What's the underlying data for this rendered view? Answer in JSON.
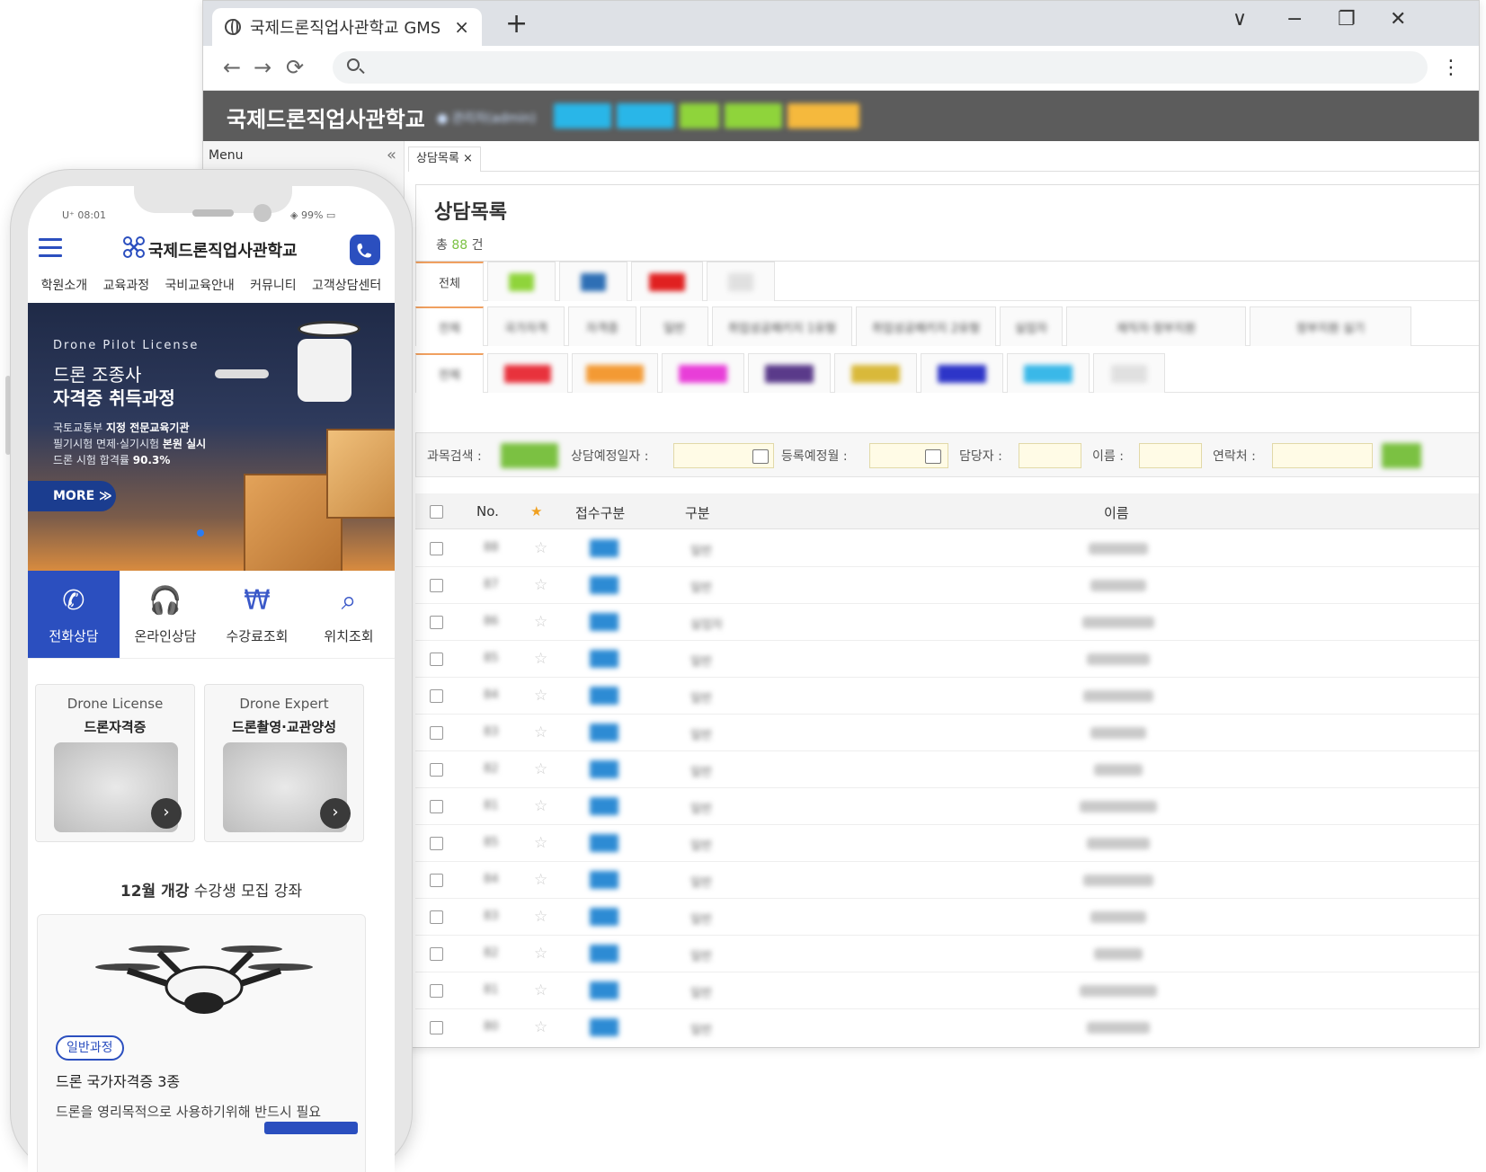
{
  "browser": {
    "tab_title": "국제드론직업사관학교 GMS",
    "tab_close": "×",
    "new_tab": "+",
    "window_controls": [
      "∨",
      "−",
      "❐",
      "✕"
    ],
    "nav": {
      "back": "←",
      "forward": "→",
      "reload": "⟳"
    },
    "menu_icon": "⋮"
  },
  "admin": {
    "brand": "국제드론직업사관학교",
    "user_info": "● 관리자(admin)",
    "header_buttons": [
      {
        "color": "#29b6e8"
      },
      {
        "color": "#29b6e8"
      },
      {
        "color": "#8fd43b"
      },
      {
        "color": "#8fd43b"
      },
      {
        "color": "#f5b93d"
      }
    ],
    "menu_title": "Menu",
    "menu_collapse": "«",
    "content_tab": "상담목록 ×",
    "page_title": "상담목록",
    "count_prefix": "총",
    "count_value": "88",
    "count_suffix": "건",
    "filter_row1": {
      "all_label": "전체",
      "chips": [
        "#8fd43b",
        "#2e6fb5",
        "#e02020",
        "#e0e0e0"
      ]
    },
    "filter_row2": {
      "all_label": "전체",
      "items": [
        "국가자격",
        "자격증",
        "일반",
        "취업성공패키지 1유형",
        "취업성공패키지 2유형",
        "실업자",
        "재직자·정부지원",
        "정부지원 실기"
      ]
    },
    "filter_row3": {
      "all_label": "전체",
      "chips": [
        "#e8323c",
        "#f39a34",
        "#e83ed8",
        "#5a3a8a",
        "#d9b93a",
        "#2d35c8",
        "#3ab8e8",
        "#e0e0e0"
      ]
    },
    "search": {
      "course_label": "과목검색 :",
      "course_btn_color": "#7bc142",
      "date_label": "상담예정일자 :",
      "month_label": "등록예정월 :",
      "staff_label": "담당자 :",
      "name_label": "이름 :",
      "phone_label": "연락처 :",
      "search_btn_color": "#7bc142"
    },
    "table": {
      "headers": {
        "no": "No.",
        "star": "★",
        "type": "접수구분",
        "category": "구분",
        "name": "이름"
      },
      "rows": [
        {
          "no": "88",
          "category": "일반"
        },
        {
          "no": "87",
          "category": "일반"
        },
        {
          "no": "86",
          "category": "실업자"
        },
        {
          "no": "85",
          "category": "일반"
        },
        {
          "no": "84",
          "category": "일반"
        },
        {
          "no": "83",
          "category": "일반"
        },
        {
          "no": "82",
          "category": "일반"
        },
        {
          "no": "81",
          "category": "일반"
        },
        {
          "no": "85",
          "category": "일반"
        },
        {
          "no": "84",
          "category": "일반"
        },
        {
          "no": "83",
          "category": "일반"
        },
        {
          "no": "82",
          "category": "일반"
        },
        {
          "no": "81",
          "category": "일반"
        },
        {
          "no": "80",
          "category": "일반"
        }
      ]
    }
  },
  "phone": {
    "status_left": "U⁺ 08:01",
    "status_right": "◈ 99% ▭",
    "site_title": "국제드론직업사관학교",
    "nav": [
      "학원소개",
      "교육과정",
      "국비교육안내",
      "커뮤니티",
      "고객상담센터"
    ],
    "hero": {
      "subtitle": "Drone Pilot License",
      "title1": "드론 조종사",
      "title2": "자격증 취득과정",
      "line1_pre": "국토교통부 ",
      "line1_bold": "지정 전문교육기관",
      "line2_pre": "필기시험 면제·실기시험 ",
      "line2_bold": "본원 실시",
      "line3_pre": "드론 시험 합격률 ",
      "line3_bold": "90.3%",
      "more": "MORE ≫"
    },
    "quick": [
      {
        "label": "전화상담",
        "icon": "✆"
      },
      {
        "label": "온라인상담",
        "icon": "🎧"
      },
      {
        "label": "수강료조회",
        "icon": "₩"
      },
      {
        "label": "위치조회",
        "icon": "⌕"
      }
    ],
    "cards": [
      {
        "en": "Drone License",
        "ko": "드론자격증"
      },
      {
        "en": "Drone Expert",
        "ko": "드론촬영·교관양성"
      }
    ],
    "section_bold": "12월 개강",
    "section_rest": " 수강생 모집 강좌",
    "course": {
      "tag": "일반과정",
      "name": "드론 국가자격증 3종",
      "desc": "드론을 영리목적으로 사용하기위해 반드시 필요"
    }
  }
}
